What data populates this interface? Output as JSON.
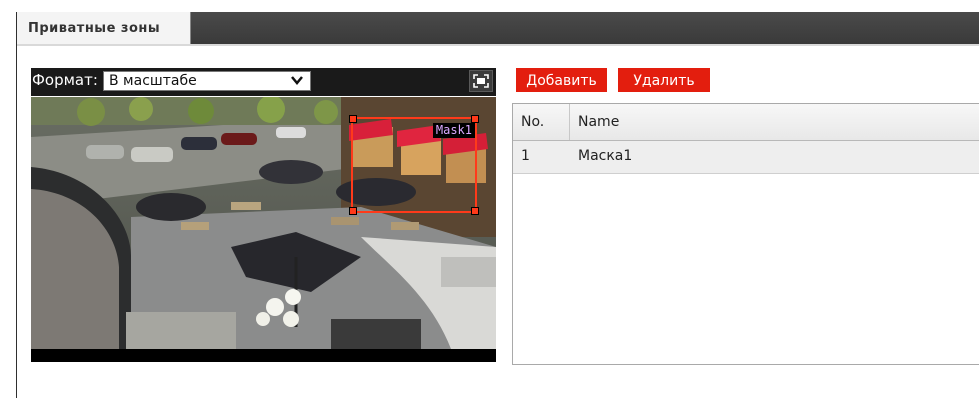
{
  "tab": {
    "label": "Приватные зоны"
  },
  "video": {
    "format_label": "Формат:",
    "format_selected": "В масштабе",
    "mask_overlay_label": "Mask1"
  },
  "buttons": {
    "add": "Добавить",
    "delete": "Удалить"
  },
  "table": {
    "columns": [
      "No.",
      "Name"
    ],
    "rows": [
      {
        "no": "1",
        "name": "Маска1"
      }
    ]
  },
  "colors": {
    "accent_red": "#e31e0e",
    "mask_border": "#ff3a1a",
    "tabbar_bg": "#3f3f3f"
  },
  "icons": {
    "fullscreen": "fullscreen-icon",
    "dropdown": "chevron-down-icon"
  }
}
